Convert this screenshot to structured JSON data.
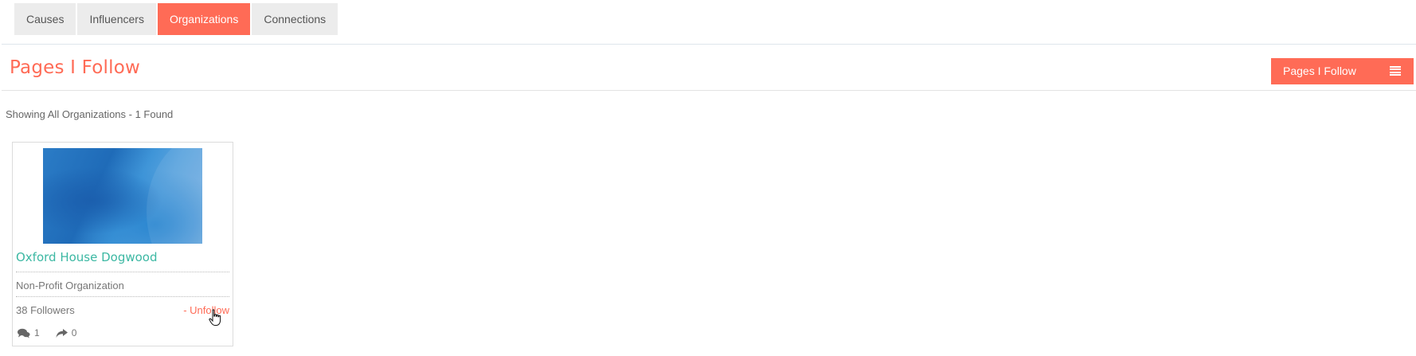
{
  "tabs": [
    {
      "label": "Causes",
      "active": false
    },
    {
      "label": "Influencers",
      "active": false
    },
    {
      "label": "Organizations",
      "active": true
    },
    {
      "label": "Connections",
      "active": false
    }
  ],
  "header": {
    "title": "Pages I Follow",
    "menu_button_label": "Pages I Follow",
    "menu_button_icon": "menu-icon"
  },
  "summary": "Showing All Organizations - 1 Found",
  "organizations": [
    {
      "name": "Oxford House Dogwood",
      "type": "Non-Profit Organization",
      "followers": "38 Followers",
      "unfollow_label": "- Unfollow",
      "comments": "1",
      "shares": "0",
      "thumbnail_icon": "organization-cover-image"
    }
  ],
  "colors": {
    "accent": "#ff6b56",
    "org_name": "#3cb8a3",
    "tab_bg": "#ececec"
  }
}
